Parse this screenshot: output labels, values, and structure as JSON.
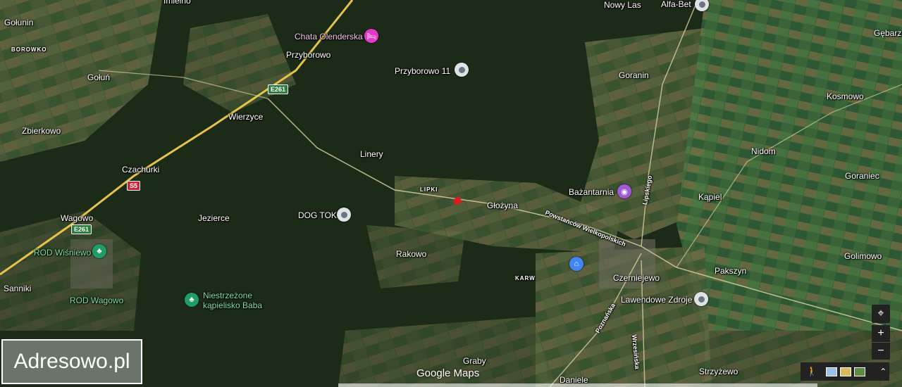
{
  "places": {
    "imielno": "Imielno",
    "golunin": "Gołunin",
    "borowko": "BOROWKO",
    "golun": "Gołuń",
    "zbierkowo": "Zbierkowo",
    "czachurki": "Czachurki",
    "wagowo": "Wagowo",
    "sanniki": "Sanniki",
    "przyborowo": "Przyborowo",
    "wierzyce": "Wierzyce",
    "linery": "Linery",
    "jezierce": "Jezierce",
    "lipki": "LIPKI",
    "glozyna": "Głożyna",
    "rakowo": "Rakowo",
    "karw": "KARW",
    "goranin": "Goranin",
    "nowy_las": "Nowy Las",
    "kosmowo": "Kosmowo",
    "gebarzew": "Gębarzew",
    "nidom": "Nidom",
    "goraniec": "Goraniec",
    "kapiel": "Kąpiel",
    "golimowo": "Golimowo",
    "pakszyn": "Pakszyn",
    "czerniejewo": "Czerniejewo",
    "graby": "Graby",
    "daniele": "Daniele",
    "strzyzewo": "Strzyżewo"
  },
  "roads": {
    "e261_a": "E261",
    "e261_b": "E261",
    "s5": "S5",
    "powstancow": "Powstańców Wielkopolskich",
    "lipskiego": "Lipskiego",
    "poznanska": "Poznańska",
    "wrzesinska": "Wrzesińska"
  },
  "pois": {
    "chata": "Chata Olenderska",
    "przyborowo11": "Przyborowo 11",
    "dogtok": "DOG TOK",
    "bazantarnia": "Bażantarnia",
    "alfabet": "Alfa-Bet",
    "lawendowe": "Lawendowe Zdroje",
    "rod_wisniewo": "ROD Wiśniewo",
    "rod_wagowo": "ROD Wagowo",
    "kapielisko": "Niestrzeżone\nkąpielisko Baba"
  },
  "icons": {
    "pin_gray": "location-pin-icon",
    "hotel": "hotel-icon",
    "camera": "camera-icon",
    "home": "home-icon",
    "tree": "park-icon"
  },
  "brand": {
    "google_maps": "Google Maps",
    "watermark": "Adresowo.pl"
  },
  "controls": {
    "locate": "⌖",
    "zoom_in": "+",
    "zoom_out": "−",
    "expand": "⌃",
    "pegman": "🚶"
  },
  "colors": {
    "forest": "#1e2f1b",
    "field": "#4a5a35",
    "road": "#d8cfa0",
    "highway": "#e6c34a",
    "marker": "#e01b1b"
  }
}
